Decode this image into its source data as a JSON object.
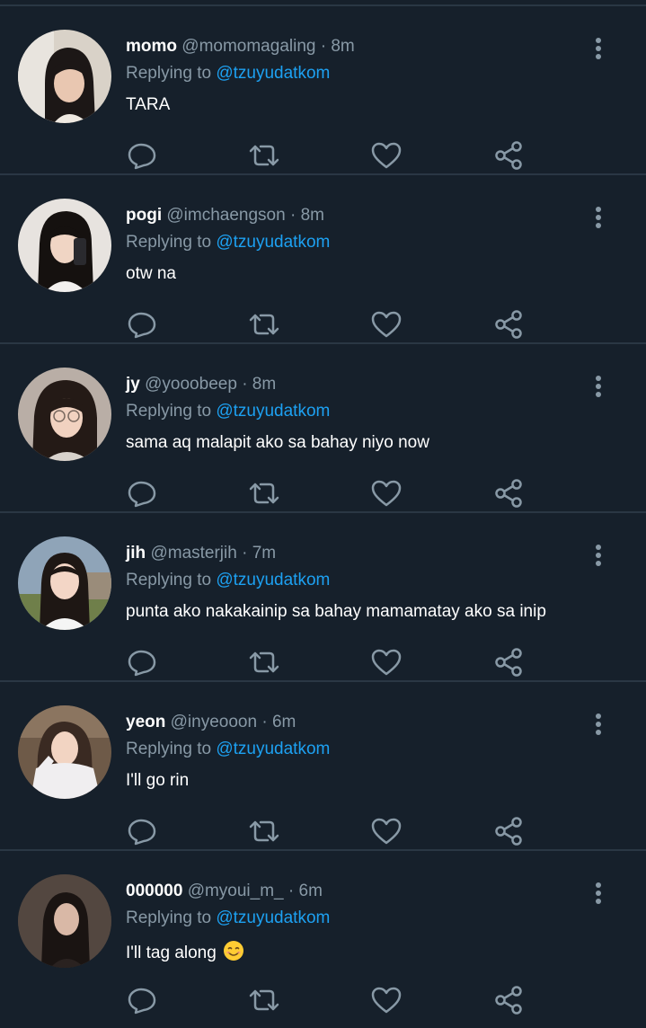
{
  "colors": {
    "background": "#16202b",
    "divider": "#2a3744",
    "muted": "#8899a6",
    "mention": "#1da1f2",
    "icon": "#8899a6"
  },
  "icons": {
    "more": "vertical-ellipsis-icon",
    "reply": "speech-bubble-icon",
    "retweet": "retweet-arrows-icon",
    "like": "heart-outline-icon",
    "share": "share-nodes-icon"
  },
  "tweets": [
    {
      "display_name": "momo",
      "handle": "@momomagaling",
      "separator": "·",
      "time": "8m",
      "replying_prefix": "Replying to",
      "replying_to": "@tzuyudatkom",
      "text": "TARA"
    },
    {
      "display_name": "pogi",
      "handle": "@imchaengson",
      "separator": "·",
      "time": "8m",
      "replying_prefix": "Replying to",
      "replying_to": "@tzuyudatkom",
      "text": "otw na"
    },
    {
      "display_name": "jy",
      "handle": "@yooobeep",
      "separator": "·",
      "time": "8m",
      "replying_prefix": "Replying to",
      "replying_to": "@tzuyudatkom",
      "text": "sama aq malapit ako sa bahay niyo now"
    },
    {
      "display_name": "jih",
      "handle": "@masterjih",
      "separator": "·",
      "time": "7m",
      "replying_prefix": "Replying to",
      "replying_to": "@tzuyudatkom",
      "text": "punta ako nakakainip sa bahay mamamatay ako sa inip"
    },
    {
      "display_name": "yeon",
      "handle": "@inyeooon",
      "separator": "·",
      "time": "6m",
      "replying_prefix": "Replying to",
      "replying_to": "@tzuyudatkom",
      "text": "I'll go rin"
    },
    {
      "display_name": "000000",
      "handle": "@myoui_m_",
      "separator": "·",
      "time": "6m",
      "replying_prefix": "Replying to",
      "replying_to": "@tzuyudatkom",
      "text": "I'll tag along",
      "emoji": "smiling-face-emoji"
    }
  ]
}
